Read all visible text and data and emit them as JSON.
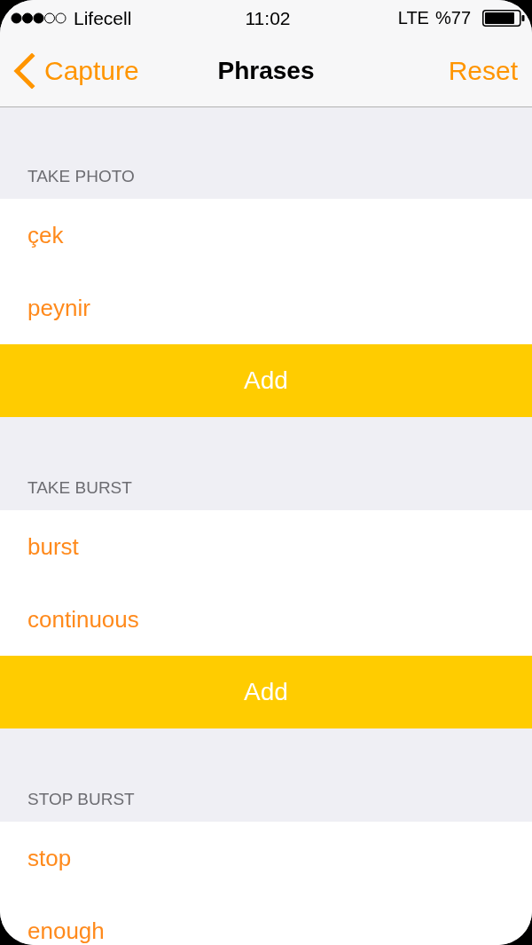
{
  "status_bar": {
    "carrier": "Lifecell",
    "time": "11:02",
    "network": "LTE",
    "battery": "%77"
  },
  "nav_bar": {
    "back": "Capture",
    "title": "Phrases",
    "action": "Reset"
  },
  "sections": [
    {
      "header": "TAKE PHOTO",
      "phrases": [
        "çek",
        "peynir"
      ],
      "button": "Add"
    },
    {
      "header": "TAKE BURST",
      "phrases": [
        "burst",
        "continuous"
      ],
      "button": "Add"
    },
    {
      "header": "STOP BURST",
      "phrases": [
        "stop",
        "enough"
      ]
    }
  ]
}
